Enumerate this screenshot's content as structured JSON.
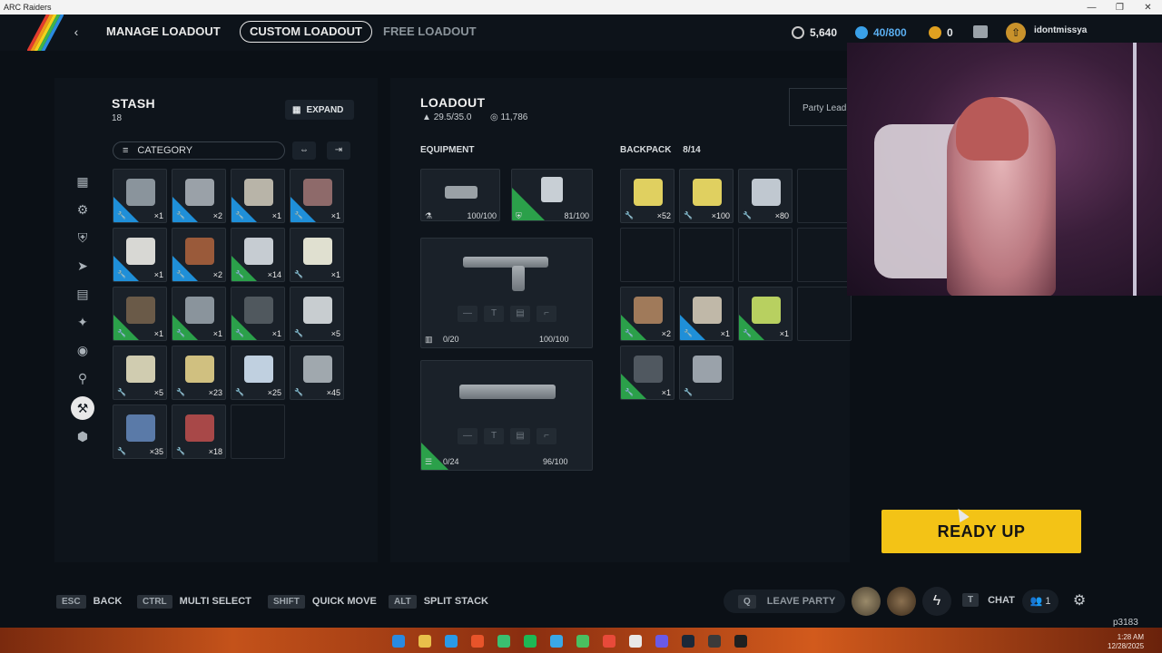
{
  "window": {
    "title": "ARC Raiders",
    "controls": [
      "—",
      "❐",
      "✕"
    ]
  },
  "topnav": {
    "back_icon": "chevron-left-icon",
    "manage_loadout": "MANAGE LOADOUT",
    "custom_loadout": "CUSTOM LOADOUT",
    "free_loadout": "FREE LOADOUT",
    "coins": "5,640",
    "raider_tokens": "40/800",
    "cred": "0",
    "username": "idontmissya",
    "colors": {
      "coins": "#c8c8c8",
      "tokens": "#3aa0e8",
      "cred": "#e0a020"
    }
  },
  "stash": {
    "title": "STASH",
    "count": "18",
    "expand_label": "EXPAND",
    "category_label": "CATEGORY",
    "items": [
      {
        "qty": "×1",
        "rarity": "blue",
        "color": "#8a949c"
      },
      {
        "qty": "×2",
        "rarity": "blue",
        "color": "#9aa1a8"
      },
      {
        "qty": "×1",
        "rarity": "blue",
        "color": "#b8b4a8"
      },
      {
        "qty": "×1",
        "rarity": "blue",
        "color": "#8e6a6a"
      },
      {
        "qty": "×1",
        "rarity": "blue",
        "color": "#d8d8d4"
      },
      {
        "qty": "×2",
        "rarity": "blue",
        "color": "#9a5a3a"
      },
      {
        "qty": "×14",
        "rarity": "green",
        "color": "#c6ccd2"
      },
      {
        "qty": "×1",
        "rarity": "none",
        "color": "#e0e0d0"
      },
      {
        "qty": "×1",
        "rarity": "green",
        "color": "#6a5a48"
      },
      {
        "qty": "×1",
        "rarity": "green",
        "color": "#8a949c"
      },
      {
        "qty": "×1",
        "rarity": "green",
        "color": "#50585e"
      },
      {
        "qty": "×5",
        "rarity": "none",
        "color": "#c8cdd0"
      },
      {
        "qty": "×5",
        "rarity": "none",
        "color": "#d0ccb0"
      },
      {
        "qty": "×23",
        "rarity": "none",
        "color": "#d0c080"
      },
      {
        "qty": "×25",
        "rarity": "none",
        "color": "#c0d0e0"
      },
      {
        "qty": "×45",
        "rarity": "none",
        "color": "#a0a8ae"
      },
      {
        "qty": "×35",
        "rarity": "none",
        "color": "#5a7aa8"
      },
      {
        "qty": "×18",
        "rarity": "none",
        "color": "#a84848"
      },
      {
        "qty": "",
        "rarity": "empty",
        "color": ""
      }
    ]
  },
  "loadout": {
    "title": "LOADOUT",
    "weight": "29.5/35.0",
    "value": "11,786",
    "equipment_label": "EQUIPMENT",
    "augment_durability": "100/100",
    "shield_durability": "81/100",
    "weapon1_ammo": "0/20",
    "weapon1_durability": "100/100",
    "weapon2_ammo": "0/24",
    "weapon2_durability": "96/100",
    "party_label": "Party Lead"
  },
  "backpack": {
    "label": "BACKPACK",
    "count": "8/14",
    "items": [
      {
        "qty": "×52",
        "rarity": "none",
        "color": "#e0d060"
      },
      {
        "qty": "×100",
        "rarity": "none",
        "color": "#e0d060"
      },
      {
        "qty": "×80",
        "rarity": "none",
        "color": "#c0c8d0"
      },
      {
        "qty": "",
        "rarity": "empty",
        "color": ""
      },
      {
        "qty": "",
        "rarity": "empty",
        "color": ""
      },
      {
        "qty": "",
        "rarity": "empty",
        "color": ""
      },
      {
        "qty": "",
        "rarity": "empty",
        "color": ""
      },
      {
        "qty": "",
        "rarity": "empty",
        "color": ""
      },
      {
        "qty": "×2",
        "rarity": "green",
        "color": "#a07a5a"
      },
      {
        "qty": "×1",
        "rarity": "blue",
        "color": "#c0b8a8"
      },
      {
        "qty": "×1",
        "rarity": "green",
        "color": "#b8d060"
      },
      {
        "qty": "",
        "rarity": "empty",
        "color": ""
      },
      {
        "qty": "×1",
        "rarity": "green",
        "color": "#505860"
      },
      {
        "qty": "",
        "rarity": "none",
        "color": "#9aa2aa"
      }
    ]
  },
  "actions": {
    "ready_up": "READY UP"
  },
  "hints": [
    {
      "key": "ESC",
      "label": "BACK"
    },
    {
      "key": "CTRL",
      "label": "MULTI SELECT"
    },
    {
      "key": "SHIFT",
      "label": "QUICK MOVE"
    },
    {
      "key": "ALT",
      "label": "SPLIT STACK"
    }
  ],
  "party": {
    "leave_key": "Q",
    "leave_label": "LEAVE PARTY",
    "chat_key": "T",
    "chat_label": "CHAT",
    "friends_count": "1",
    "code": "p3183"
  },
  "taskbar": {
    "time": "1:28 AM",
    "date": "12/28/2025"
  }
}
